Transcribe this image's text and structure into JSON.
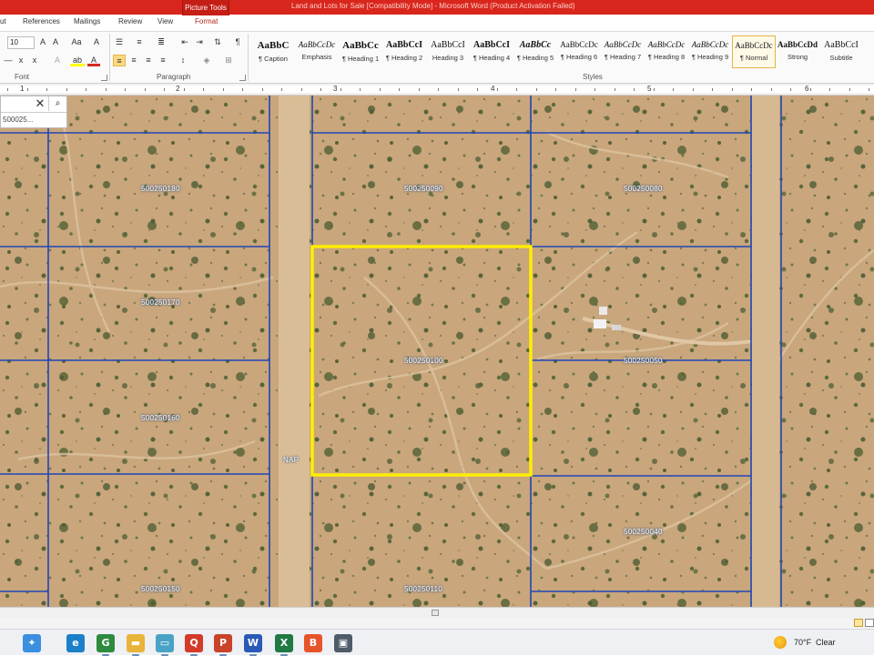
{
  "window": {
    "title": "Land and Lots for Sale [Compatibility Mode] - Microsoft Word (Product Activation Failed)",
    "contextual_tab_group": "Picture Tools"
  },
  "tabs": [
    {
      "label": "ut"
    },
    {
      "label": "References"
    },
    {
      "label": "Mailings"
    },
    {
      "label": "Review"
    },
    {
      "label": "View"
    },
    {
      "label": "Format"
    }
  ],
  "ribbon": {
    "font_size": "10",
    "font_group_label": "Font",
    "paragraph_group_label": "Paragraph",
    "styles_group_label": "Styles",
    "font_buttons": {
      "grow": "A",
      "shrink": "A",
      "change_case": "Aa",
      "clear": "A",
      "subscript": "x",
      "superscript": "x",
      "effects": "A",
      "highlight": "ab",
      "color": "A"
    },
    "accent_colors": {
      "font_color": "#d42a1f",
      "highlight": "#ffff00",
      "selected": "#fcd982"
    },
    "styles": [
      {
        "sample": "AaBbC",
        "name": "¶ Caption"
      },
      {
        "sample": "AaBbCcDc",
        "name": "Emphasis"
      },
      {
        "sample": "AaBbCc",
        "name": "¶ Heading 1"
      },
      {
        "sample": "AaBbCcI",
        "name": "¶ Heading 2"
      },
      {
        "sample": "AaBbCcI",
        "name": "Heading 3"
      },
      {
        "sample": "AaBbCcI",
        "name": "¶ Heading 4"
      },
      {
        "sample": "AaBbCc",
        "name": "¶ Heading 5"
      },
      {
        "sample": "AaBbCcDc",
        "name": "¶ Heading 6"
      },
      {
        "sample": "AaBbCcDc",
        "name": "¶ Heading 7"
      },
      {
        "sample": "AaBbCcDc",
        "name": "¶ Heading 8"
      },
      {
        "sample": "AaBbCcDc",
        "name": "¶ Heading 9"
      },
      {
        "sample": "AaBbCcDc",
        "name": "¶ Normal"
      },
      {
        "sample": "AaBbCcDd",
        "name": "Strong"
      },
      {
        "sample": "AaBbCcI",
        "name": "Subtitle"
      }
    ],
    "selected_style": "¶ Normal"
  },
  "ruler": {
    "numbers": [
      "1",
      "2",
      "3",
      "4",
      "5",
      "6"
    ]
  },
  "map": {
    "search_value": "500025...",
    "colors": {
      "parcel_lines": "#1f46b5",
      "highlight": "#ffee00",
      "ground": "#c9a67c"
    },
    "parcel_labels": [
      "500250180",
      "500250090",
      "500250080",
      "500250170",
      "500250100",
      "500250050",
      "500250160",
      "500250040",
      "500250150",
      "500250110"
    ],
    "road_label": "NAP",
    "highlighted_parcel": "500250100"
  },
  "taskbar": {
    "icons": [
      {
        "name": "copilot-icon",
        "glyph": "✦",
        "color": "#3b8fe0"
      },
      {
        "name": "edge-icon",
        "glyph": "e",
        "color": "#1b7fc9"
      },
      {
        "name": "chrome-icon",
        "glyph": "G",
        "color": "#2e8b3e"
      },
      {
        "name": "file-explorer-icon",
        "glyph": "▬",
        "color": "#e9b43a"
      },
      {
        "name": "photos-icon",
        "glyph": "▭",
        "color": "#4aa3c7"
      },
      {
        "name": "pdf-reader-icon",
        "glyph": "Q",
        "color": "#d43a2a"
      },
      {
        "name": "powerpoint-icon",
        "glyph": "P",
        "color": "#c9432a"
      },
      {
        "name": "word-icon",
        "glyph": "W",
        "color": "#2a5ab6"
      },
      {
        "name": "excel-icon",
        "glyph": "X",
        "color": "#1f7a43"
      },
      {
        "name": "brave-icon",
        "glyph": "B",
        "color": "#e8542a"
      },
      {
        "name": "snipping-tool-icon",
        "glyph": "▣",
        "color": "#4f5b69"
      }
    ],
    "weather": {
      "temperature": "70°F",
      "condition": "Clear"
    }
  }
}
